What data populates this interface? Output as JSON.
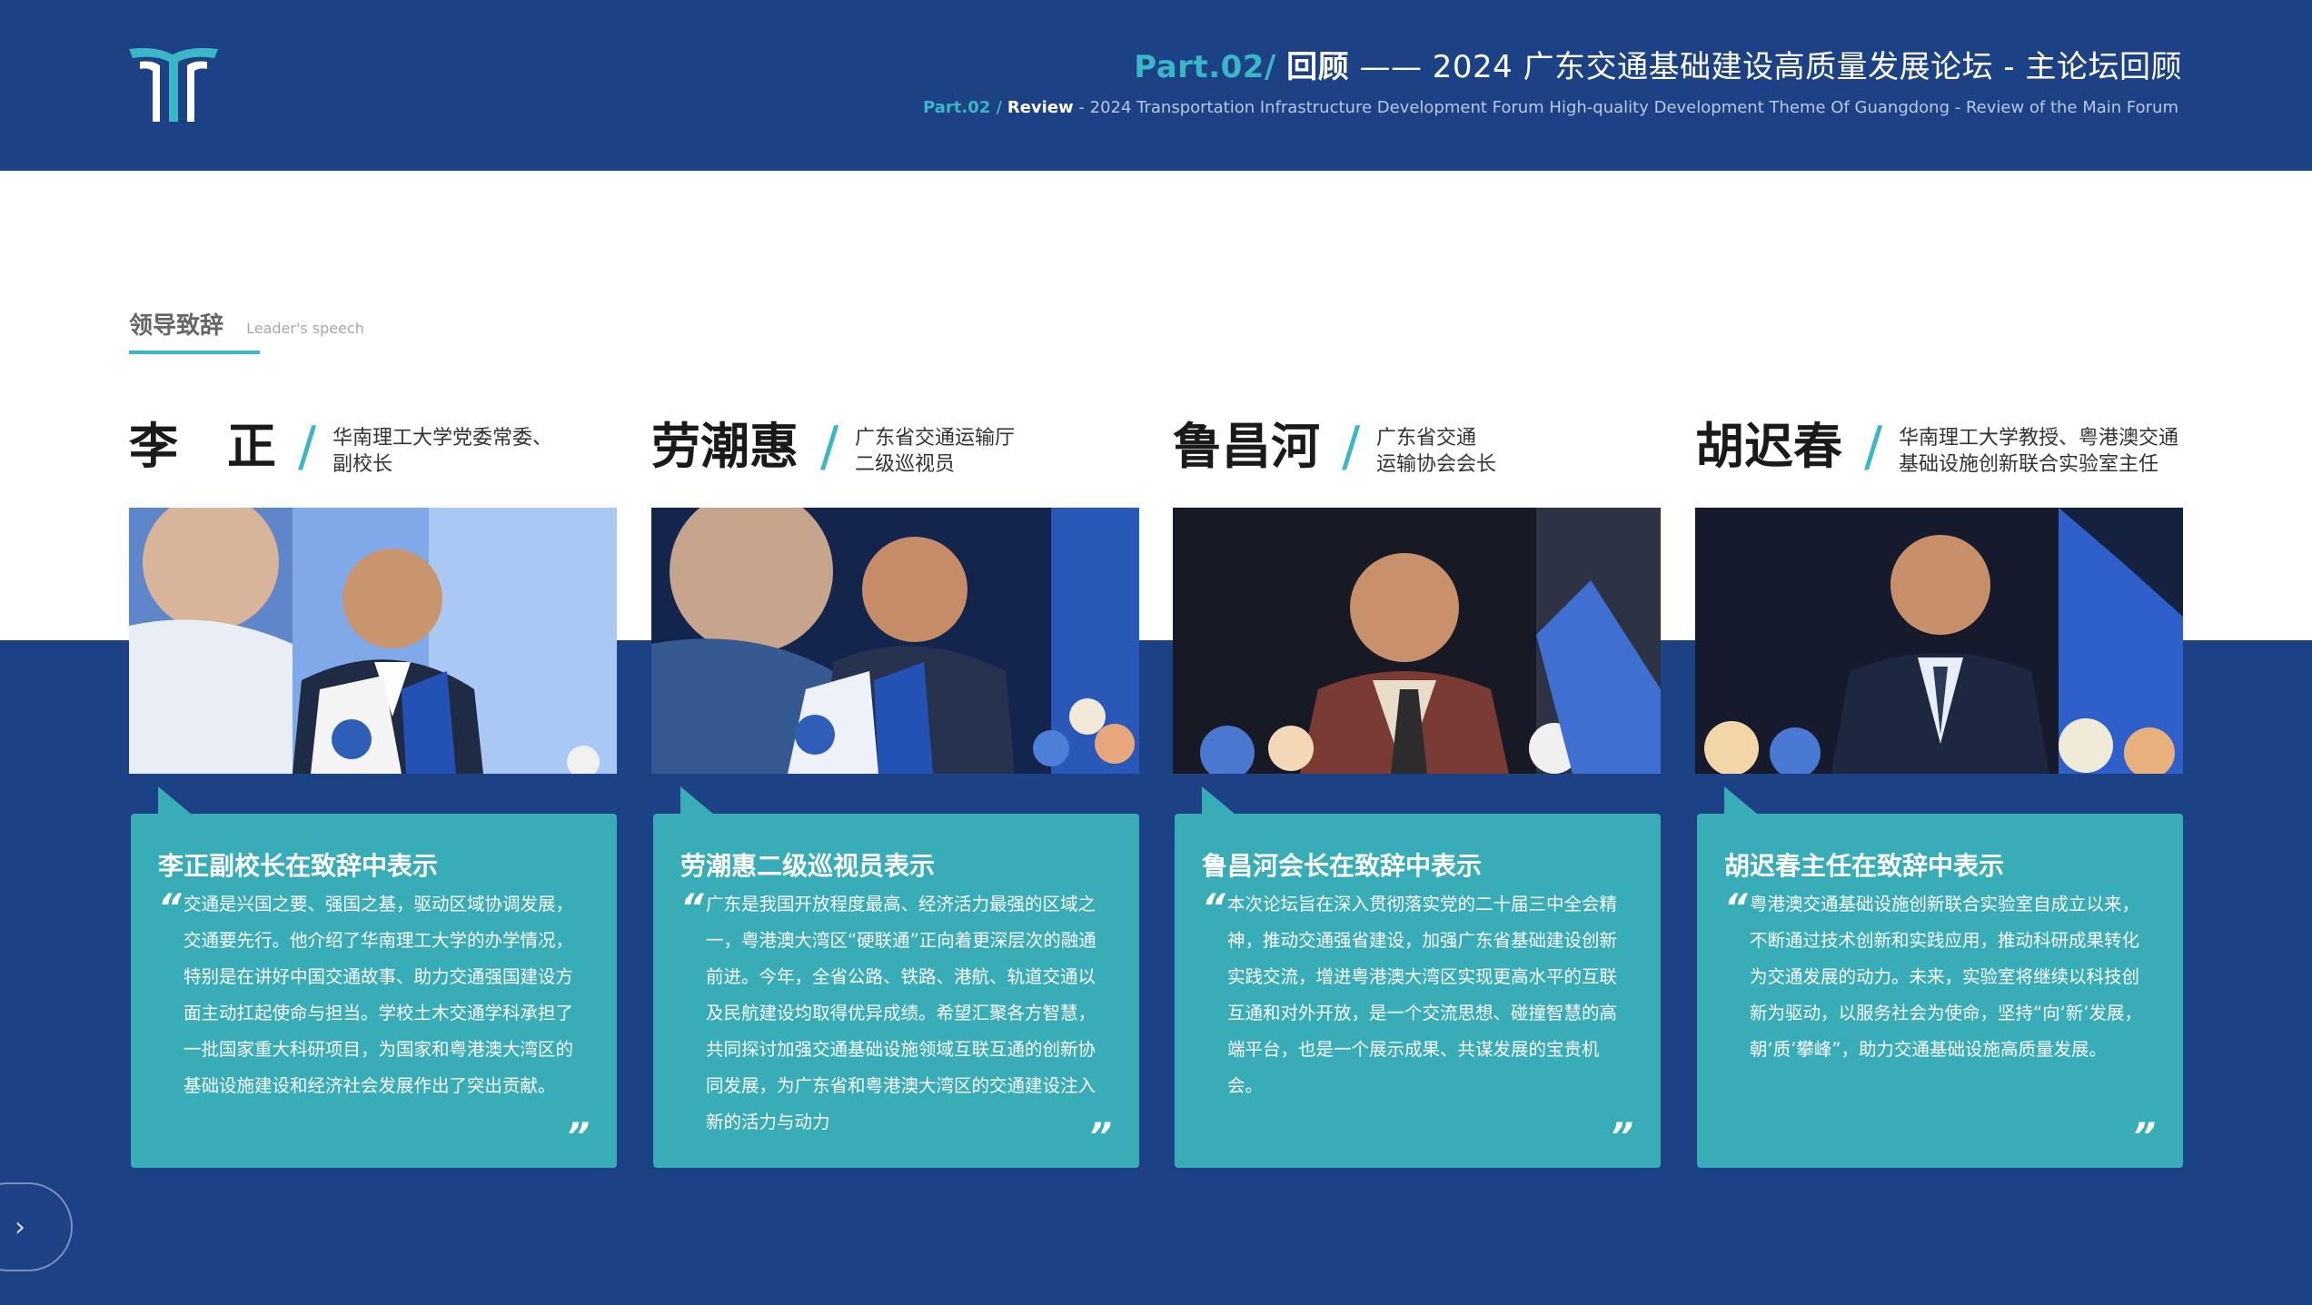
{
  "header": {
    "part": "Part.02",
    "part_slash": "/",
    "review_cn": "回顾",
    "dash": "——",
    "title_cn": "2024 广东交通基础建设高质量发展论坛 - 主论坛回顾",
    "sub_part": "Part.02 /",
    "sub_review": "Review",
    "sub_title": "- 2024 Transportation Infrastructure Development Forum High-quality Development Theme Of Guangdong - Review of the Main Forum"
  },
  "section": {
    "title": "领导致辞",
    "subtitle": "Leader's speech"
  },
  "speakers": [
    {
      "name": "李　正",
      "title_line1": "华南理工大学党委常委、",
      "title_line2": "副校长",
      "card_title": "李正副校长在致辞中表示",
      "quote": "交通是兴国之要、强国之基，驱动区域协调发展，交通要先行。他介绍了华南理工大学的办学情况，特别是在讲好中国交通故事、助力交通强国建设方面主动扛起使命与担当。学校土木交通学科承担了一批国家重大科研项目，为国家和粤港澳大湾区的基础设施建设和经济社会发展作出了突出贡献。"
    },
    {
      "name": "劳潮惠",
      "title_line1": "广东省交通运输厅",
      "title_line2": "二级巡视员",
      "card_title": "劳潮惠二级巡视员表示",
      "quote": "广东是我国开放程度最高、经济活力最强的区域之一，粤港澳大湾区“硬联通”正向着更深层次的融通前进。今年，全省公路、铁路、港航、轨道交通以及民航建设均取得优异成绩。希望汇聚各方智慧，共同探讨加强交通基础设施领域互联互通的创新协同发展，为广东省和粤港澳大湾区的交通建设注入新的活力与动力"
    },
    {
      "name": "鲁昌河",
      "title_line1": "广东省交通",
      "title_line2": "运输协会会长",
      "card_title": "鲁昌河会长在致辞中表示",
      "quote": "本次论坛旨在深入贯彻落实党的二十届三中全会精神，推动交通强省建设，加强广东省基础建设创新实践交流，增进粤港澳大湾区实现更高水平的互联互通和对外开放，是一个交流思想、碰撞智慧的高端平台，也是一个展示成果、共谋发展的宝贵机会。"
    },
    {
      "name": "胡迟春",
      "title_line1": "华南理工大学教授、粤港澳交通",
      "title_line2": "基础设施创新联合实验室主任",
      "card_title": "胡迟春主任在致辞中表示",
      "quote": "粤港澳交通基础设施创新联合实验室自成立以来，不断通过技术创新和实践应用，推动科研成果转化为交通发展的动力。未来，实验室将继续以科技创新为驱动，以服务社会为使命，坚持“向‘新’发展，朝‘质’攀峰”，助力交通基础设施高质量发展。"
    }
  ],
  "quote_open": "“",
  "quote_close": "”",
  "nav": {
    "next_icon": "chevron-right-icon",
    "next_glyph": "›"
  },
  "colors": {
    "navy": "#1c4185",
    "teal": "#38adb8",
    "accent": "#3ab6c7"
  }
}
